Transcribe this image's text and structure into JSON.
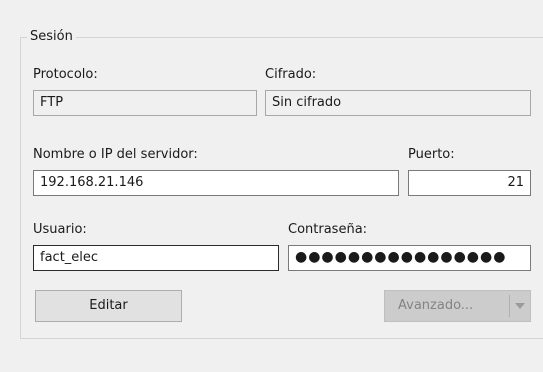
{
  "session": {
    "group_title": "Sesión",
    "protocol": {
      "label": "Protocolo:",
      "value": "FTP"
    },
    "encryption": {
      "label": "Cifrado:",
      "value": "Sin cifrado"
    },
    "host": {
      "label": "Nombre o IP del servidor:",
      "value": "192.168.21.146"
    },
    "port": {
      "label": "Puerto:",
      "value": "21"
    },
    "user": {
      "label": "Usuario:",
      "value": "fact_elec"
    },
    "password": {
      "label": "Contraseña:",
      "value": "●●●●●●●●●●●●●●●●"
    },
    "edit_button": "Editar",
    "advanced_button": "Avanzado...",
    "advanced_arrow_icon": "chevron-down-icon"
  }
}
